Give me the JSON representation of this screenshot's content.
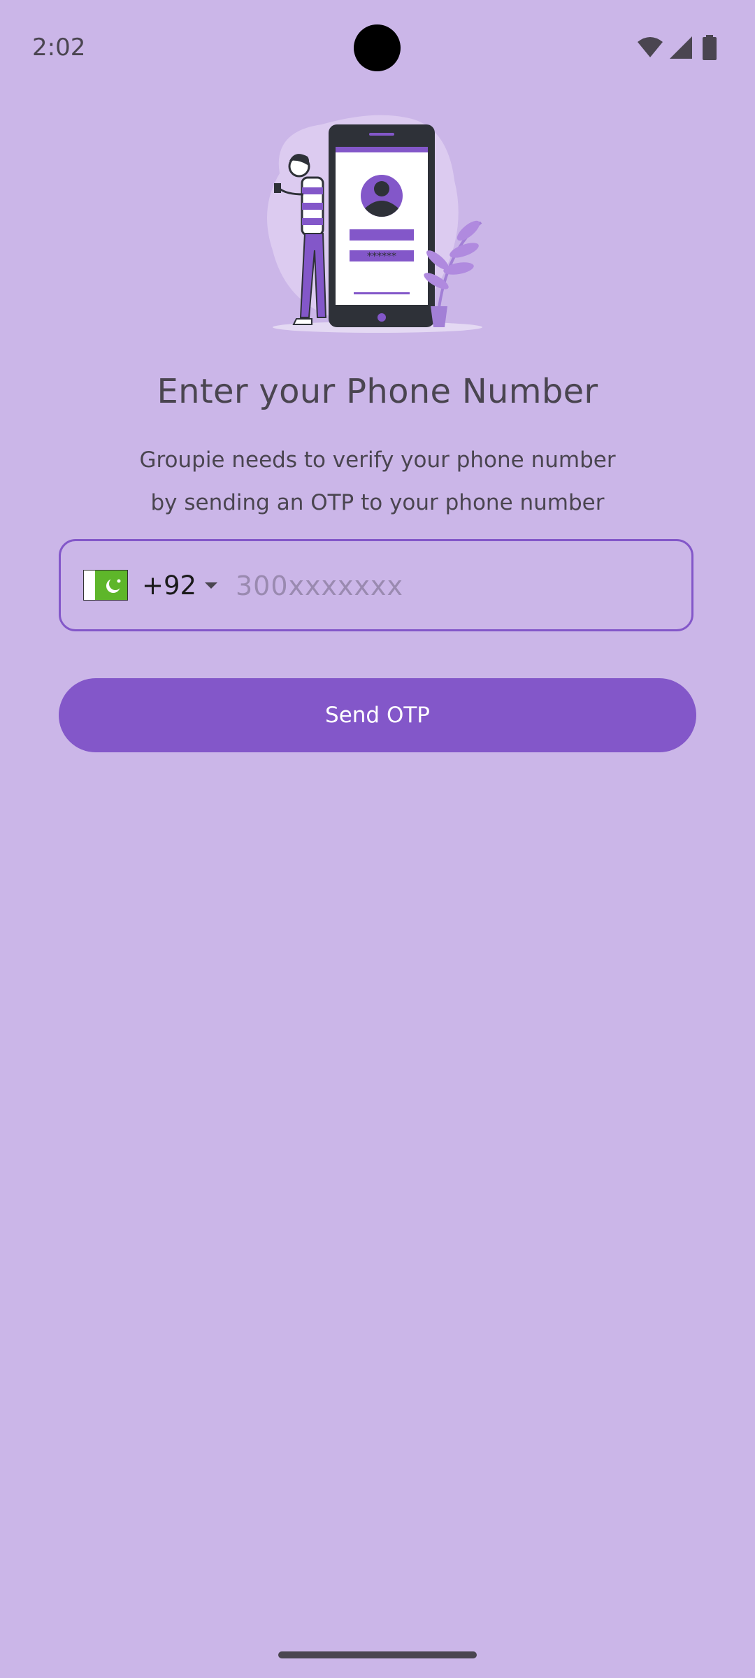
{
  "status_bar": {
    "time": "2:02",
    "icons": [
      "wifi-icon",
      "signal-icon",
      "battery-icon"
    ]
  },
  "illustration": {
    "password_mask": "******"
  },
  "title": "Enter your Phone Number",
  "subtitle": {
    "line1": "Groupie needs to verify your phone number",
    "line2": "by sending an OTP to your phone number"
  },
  "phone_field": {
    "country_flag": "pakistan-flag-icon",
    "dial_code": "+92",
    "value": "",
    "placeholder": "300xxxxxxx"
  },
  "send_button": {
    "label": "Send OTP"
  },
  "colors": {
    "background": "#CBB6E8",
    "accent": "#8357C9",
    "text": "#4A4550"
  }
}
